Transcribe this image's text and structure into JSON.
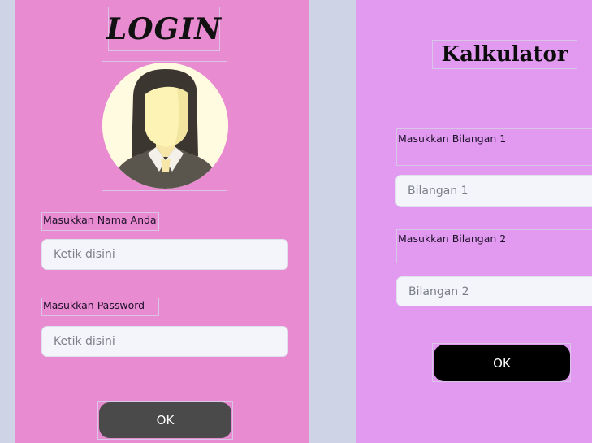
{
  "login": {
    "title": "LOGIN",
    "name_label": "Masukkan Nama Anda",
    "name_placeholder": "Ketik disini",
    "password_label": "Masukkan Password",
    "password_placeholder": "Ketik disini",
    "ok_label": "OK",
    "colors": {
      "background": "#e88bd0",
      "button": "#4a4a4a"
    }
  },
  "calculator": {
    "title": "Kalkulator",
    "num1_label": "Masukkan Bilangan 1",
    "num1_placeholder": "Bilangan 1",
    "num2_label": "Masukkan Bilangan 2",
    "num2_placeholder": "Bilangan 2",
    "ok_label": "OK",
    "colors": {
      "background": "#e19af0",
      "button": "#000000"
    }
  },
  "icons": {
    "avatar": "user-avatar-icon"
  }
}
